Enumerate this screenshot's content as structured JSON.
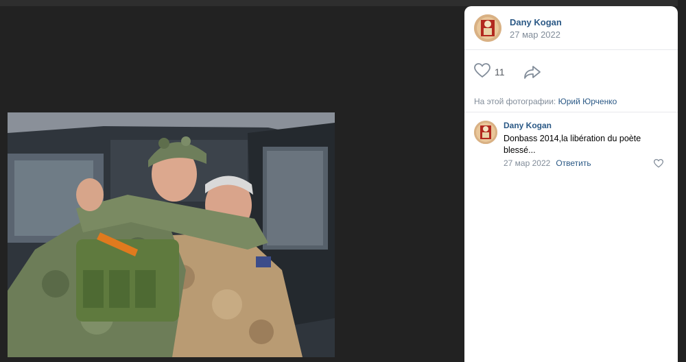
{
  "post": {
    "author": "Dany Kogan",
    "date": "27 мар 2022",
    "likes": "11",
    "tagged_label": "На этой фотографии:",
    "tagged_person": "Юрий Юрченко"
  },
  "comments": [
    {
      "author": "Dany Kogan",
      "text": "Donbass 2014,la libération du poète blessé...",
      "date": "27 мар 2022",
      "reply_label": "Ответить"
    }
  ],
  "icons": {
    "like": "heart-icon",
    "share": "share-arrow-icon",
    "comment_like": "heart-icon"
  },
  "colors": {
    "link": "#2a5885",
    "muted": "#818c99",
    "background": "#222222"
  }
}
